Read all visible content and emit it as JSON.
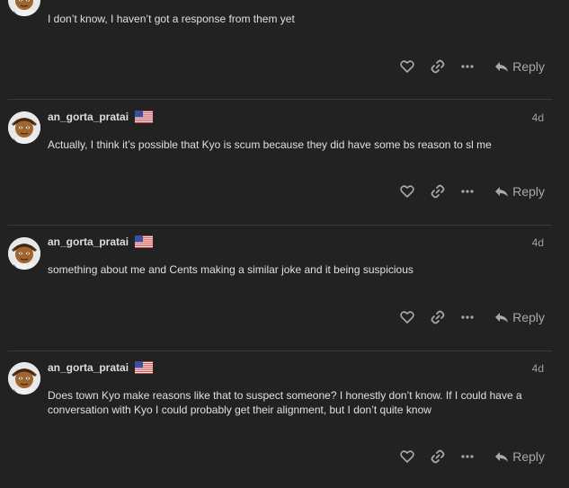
{
  "colors": {
    "background": "#222222",
    "text": "#dddddd",
    "muted": "#a0a0a0",
    "divider": "#3a3a3a"
  },
  "posts": [
    {
      "username": "",
      "date": "",
      "text": "I don’t know, I haven’t got a response from them yet",
      "reply_label": "Reply"
    },
    {
      "username": "an_gorta_pratai",
      "date": "4d",
      "text": "Actually, I think it’s possible that Kyo is scum because they did have some bs reason to sl me",
      "reply_label": "Reply"
    },
    {
      "username": "an_gorta_pratai",
      "date": "4d",
      "text": "something about me and Cents making a similar joke and it being suspicious",
      "reply_label": "Reply"
    },
    {
      "username": "an_gorta_pratai",
      "date": "4d",
      "text": "Does town Kyo make reasons like that to suspect someone? I honestly don’t know. If I could have a conversation with Kyo I could probably get their alignment, but I don’t quite know",
      "reply_label": "Reply"
    }
  ],
  "icons": [
    "heart-icon",
    "link-icon",
    "more-icon",
    "reply-icon",
    "flag-us-icon"
  ]
}
